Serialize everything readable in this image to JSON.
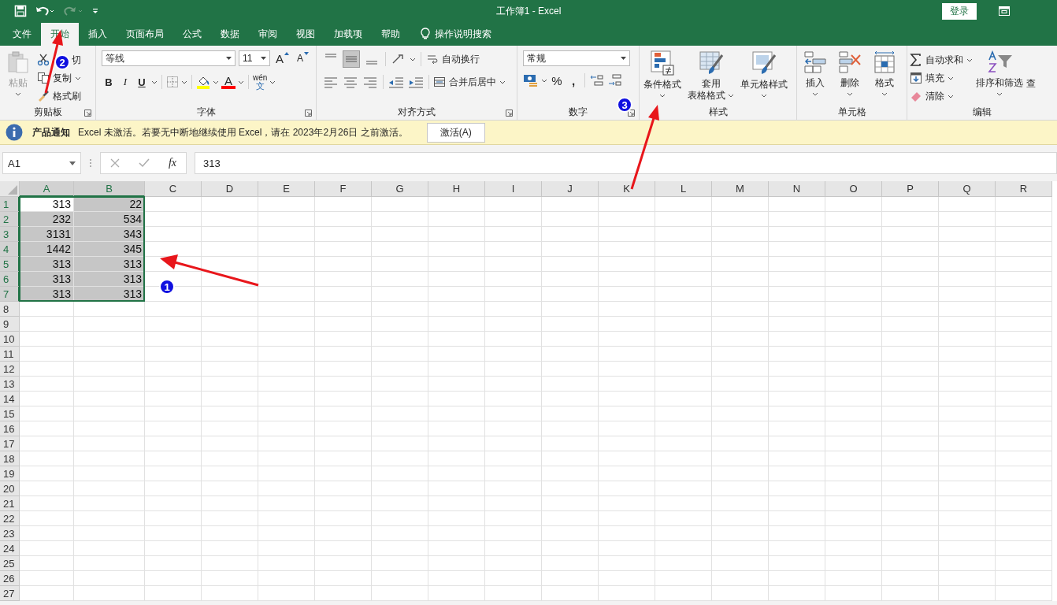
{
  "title_bar": {
    "title": "工作簿1  -  Excel",
    "sign_in": "登录"
  },
  "tabs": [
    {
      "label": "文件",
      "selected": false
    },
    {
      "label": "开始",
      "selected": true
    },
    {
      "label": "插入",
      "selected": false
    },
    {
      "label": "页面布局",
      "selected": false
    },
    {
      "label": "公式",
      "selected": false
    },
    {
      "label": "数据",
      "selected": false
    },
    {
      "label": "审阅",
      "selected": false
    },
    {
      "label": "视图",
      "selected": false
    },
    {
      "label": "加载项",
      "selected": false
    },
    {
      "label": "帮助",
      "selected": false
    }
  ],
  "tell_me": "操作说明搜索",
  "ribbon": {
    "clipboard": {
      "label": "剪贴板",
      "paste": "粘贴",
      "cut": "切",
      "copy": "复制",
      "format_painter": "格式刷"
    },
    "font": {
      "label": "字体",
      "name": "等线",
      "size": "11",
      "grow": "A",
      "shrink": "A",
      "bold": "B",
      "italic": "I",
      "underline": "U",
      "font_color": "A",
      "phonetic_top": "wén",
      "phonetic_bottom": "文"
    },
    "alignment": {
      "label": "对齐方式",
      "wrap": "自动换行",
      "merge": "合并后居中"
    },
    "number": {
      "label": "数字",
      "format": "常规",
      "percent": "%",
      "comma": ","
    },
    "styles": {
      "label": "样式",
      "conditional": "条件格式",
      "table_top": "套用",
      "table_bottom": "表格格式",
      "cell_styles": "单元格样式"
    },
    "cells": {
      "label": "单元格",
      "insert": "插入",
      "delete": "删除",
      "format": "格式"
    },
    "editing": {
      "label": "编辑",
      "autosum": "自动求和",
      "fill": "填充",
      "clear": "清除",
      "sort": "排序和筛选",
      "find": "查"
    }
  },
  "notice": {
    "title": "产品通知",
    "message": "Excel 未激活。若要无中断地继续使用 Excel，请在 2023年2月26日 之前激活。",
    "button": "激活(A)"
  },
  "formula_bar": {
    "name_box": "A1",
    "fx": "fx",
    "formula": "313"
  },
  "sheet": {
    "columns": [
      {
        "label": "A",
        "selected": true
      },
      {
        "label": "B",
        "selected": true
      },
      {
        "label": "C",
        "selected": false
      },
      {
        "label": "D",
        "selected": false
      },
      {
        "label": "E",
        "selected": false
      },
      {
        "label": "F",
        "selected": false
      },
      {
        "label": "G",
        "selected": false
      },
      {
        "label": "H",
        "selected": false
      },
      {
        "label": "I",
        "selected": false
      },
      {
        "label": "J",
        "selected": false
      },
      {
        "label": "K",
        "selected": false
      },
      {
        "label": "L",
        "selected": false
      },
      {
        "label": "M",
        "selected": false
      },
      {
        "label": "N",
        "selected": false
      },
      {
        "label": "O",
        "selected": false
      },
      {
        "label": "P",
        "selected": false
      },
      {
        "label": "Q",
        "selected": false
      },
      {
        "label": "R",
        "selected": false
      }
    ],
    "rows": [
      {
        "label": "1",
        "selected": true,
        "cells": [
          {
            "value": "313",
            "selected": true,
            "active": true
          },
          {
            "value": "22",
            "selected": true,
            "active": false
          }
        ]
      },
      {
        "label": "2",
        "selected": true,
        "cells": [
          {
            "value": "232",
            "selected": true,
            "active": false
          },
          {
            "value": "534",
            "selected": true,
            "active": false
          }
        ]
      },
      {
        "label": "3",
        "selected": true,
        "cells": [
          {
            "value": "3131",
            "selected": true,
            "active": false
          },
          {
            "value": "343",
            "selected": true,
            "active": false
          }
        ]
      },
      {
        "label": "4",
        "selected": true,
        "cells": [
          {
            "value": "1442",
            "selected": true,
            "active": false
          },
          {
            "value": "345",
            "selected": true,
            "active": false
          }
        ]
      },
      {
        "label": "5",
        "selected": true,
        "cells": [
          {
            "value": "313",
            "selected": true,
            "active": false
          },
          {
            "value": "313",
            "selected": true,
            "active": false
          }
        ]
      },
      {
        "label": "6",
        "selected": true,
        "cells": [
          {
            "value": "313",
            "selected": true,
            "active": false
          },
          {
            "value": "313",
            "selected": true,
            "active": false
          }
        ]
      },
      {
        "label": "7",
        "selected": true,
        "cells": [
          {
            "value": "313",
            "selected": true,
            "active": false
          },
          {
            "value": "313",
            "selected": true,
            "active": false
          }
        ]
      },
      {
        "label": "8",
        "selected": false,
        "cells": []
      },
      {
        "label": "9",
        "selected": false,
        "cells": []
      },
      {
        "label": "10",
        "selected": false,
        "cells": []
      },
      {
        "label": "11",
        "selected": false,
        "cells": []
      },
      {
        "label": "12",
        "selected": false,
        "cells": []
      },
      {
        "label": "13",
        "selected": false,
        "cells": []
      },
      {
        "label": "14",
        "selected": false,
        "cells": []
      },
      {
        "label": "15",
        "selected": false,
        "cells": []
      },
      {
        "label": "16",
        "selected": false,
        "cells": []
      },
      {
        "label": "17",
        "selected": false,
        "cells": []
      },
      {
        "label": "18",
        "selected": false,
        "cells": []
      },
      {
        "label": "19",
        "selected": false,
        "cells": []
      },
      {
        "label": "20",
        "selected": false,
        "cells": []
      },
      {
        "label": "21",
        "selected": false,
        "cells": []
      },
      {
        "label": "22",
        "selected": false,
        "cells": []
      },
      {
        "label": "23",
        "selected": false,
        "cells": []
      },
      {
        "label": "24",
        "selected": false,
        "cells": []
      },
      {
        "label": "25",
        "selected": false,
        "cells": []
      },
      {
        "label": "26",
        "selected": false,
        "cells": []
      },
      {
        "label": "27",
        "selected": false,
        "cells": []
      }
    ]
  },
  "annotations": [
    {
      "label": "1"
    },
    {
      "label": "2"
    },
    {
      "label": "3"
    }
  ]
}
